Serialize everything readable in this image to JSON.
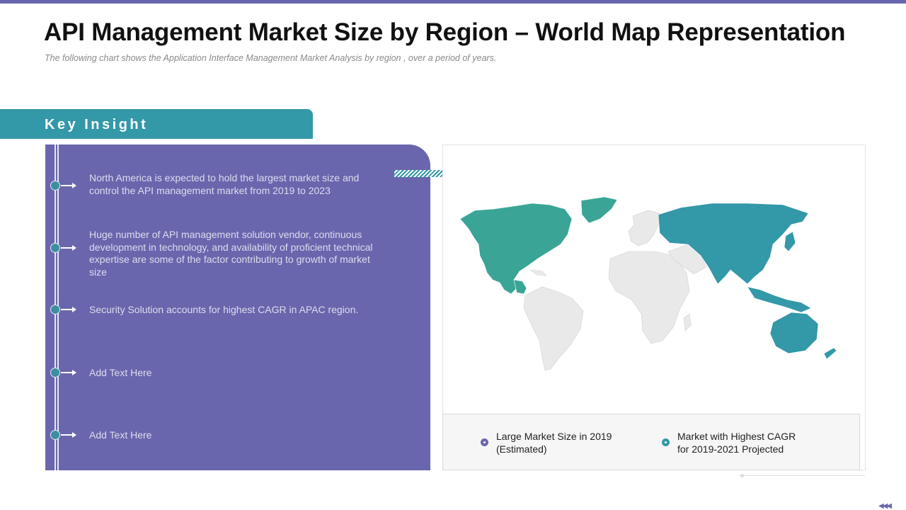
{
  "header": {
    "title": "API Management Market Size by Region – World Map Representation",
    "subtitle": "The following  chart shows the Application Interface Management  Market Analysis by region , over a period  of years."
  },
  "key_insight": {
    "label": "Key Insight",
    "items": [
      "North America is expected to hold the largest market size and control the API management market from 2019 to 2023",
      "Huge number of API management solution vendor, continuous development in technology, and availability of proficient technical expertise are some of the factor contributing to growth of market size",
      "Security Solution accounts for highest CAGR in APAC region.",
      "Add Text Here",
      "Add Text Here"
    ]
  },
  "legend": {
    "items": [
      {
        "label": "Large Market Size in 2019 (Estimated)",
        "color": "#6a66ad"
      },
      {
        "label": "Market with Highest CAGR for 2019-2021 Projected",
        "color": "#3398a8"
      }
    ]
  },
  "colors": {
    "accent_purple": "#6a66ad",
    "accent_teal": "#3398a8",
    "map_north_america": "#3aa596",
    "map_apac": "#3398a8",
    "map_other": "#e9e9e9"
  },
  "icons": {
    "nav": "triple-left-arrow-icon"
  }
}
